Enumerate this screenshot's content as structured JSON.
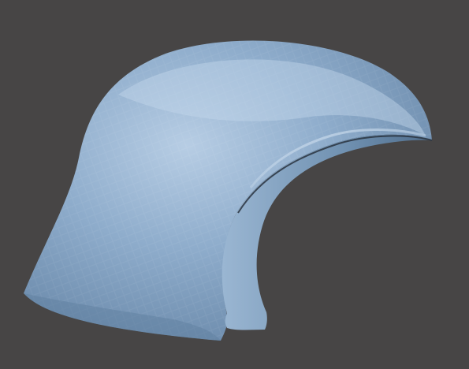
{
  "viewport": {
    "background_color": "#474545",
    "object_name": "helmet-shell-mesh",
    "object_base_color": "#8aa8c8",
    "object_highlight_color": "#c4d8ec",
    "object_shadow_color": "#5f7f9f",
    "object_edge_color": "#2a3440"
  }
}
